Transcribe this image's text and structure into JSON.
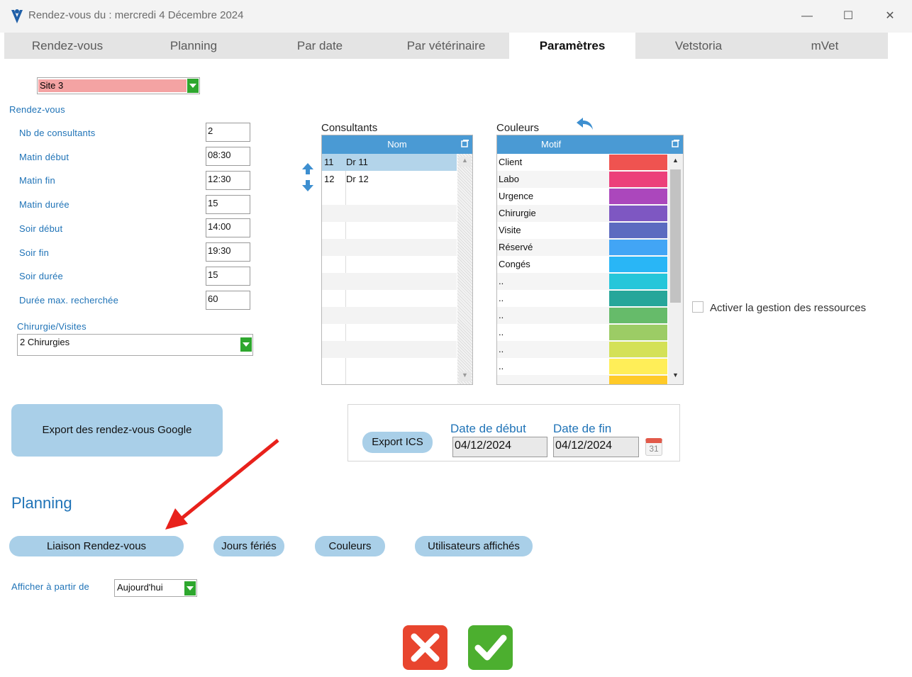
{
  "window": {
    "title": "Rendez-vous du : mercredi 4 Décembre 2024",
    "minimize": "—",
    "maximize": "☐",
    "close": "✕"
  },
  "tabs": [
    "Rendez-vous",
    "Planning",
    "Par date",
    "Par vétérinaire",
    "Paramètres",
    "Vetstoria",
    "mVet"
  ],
  "active_tab": "Paramètres",
  "site": {
    "value": "Site 3"
  },
  "rdv_section": "Rendez-vous",
  "fields": [
    {
      "label": "Nb de consultants",
      "value": "2"
    },
    {
      "label": "Matin début",
      "value": "08:30"
    },
    {
      "label": "Matin fin",
      "value": "12:30"
    },
    {
      "label": "Matin durée",
      "value": "15"
    },
    {
      "label": "Soir début",
      "value": "14:00"
    },
    {
      "label": "Soir fin",
      "value": "19:30"
    },
    {
      "label": "Soir durée",
      "value": "15"
    },
    {
      "label": "Durée max. recherchée",
      "value": "60"
    }
  ],
  "chirurgie": {
    "label": "Chirurgie/Visites",
    "value": "2 Chirurgies"
  },
  "consultants": {
    "title": "Consultants",
    "column": "Nom",
    "rows": [
      {
        "id": "11",
        "name": "Dr 11"
      },
      {
        "id": "12",
        "name": "Dr 12"
      }
    ]
  },
  "couleurs": {
    "title": "Couleurs",
    "column": "Motif",
    "rows": [
      {
        "motif": "Client",
        "color": "#ef5350"
      },
      {
        "motif": "Labo",
        "color": "#ec407a"
      },
      {
        "motif": "Urgence",
        "color": "#ab47bc"
      },
      {
        "motif": "Chirurgie",
        "color": "#7e57c2"
      },
      {
        "motif": "Visite",
        "color": "#5c6bc0"
      },
      {
        "motif": "Réservé",
        "color": "#42a5f5"
      },
      {
        "motif": "Congés",
        "color": "#29b6f6"
      },
      {
        "motif": "..",
        "color": "#26c6da"
      },
      {
        "motif": "..",
        "color": "#26a69a"
      },
      {
        "motif": "..",
        "color": "#66bb6a"
      },
      {
        "motif": "..",
        "color": "#9ccc65"
      },
      {
        "motif": "..",
        "color": "#d4e157"
      },
      {
        "motif": "..",
        "color": "#ffee58"
      },
      {
        "motif": "",
        "color": "#ffca28"
      }
    ]
  },
  "ressources": {
    "label": "Activer la gestion des ressources"
  },
  "export_google": "Export des rendez-vous Google",
  "export_ics": {
    "button": "Export ICS",
    "start_label": "Date de début",
    "start_value": "04/12/2024",
    "end_label": "Date de fin",
    "end_value": "04/12/2024",
    "calendar_day": "31"
  },
  "planning": {
    "title": "Planning",
    "buttons": [
      "Liaison Rendez-vous",
      "Jours fériés",
      "Couleurs",
      "Utilisateurs affichés"
    ],
    "afficher_label": "Afficher à partir de",
    "afficher_value": "Aujourd'hui"
  },
  "colors": {
    "accent": "#1f73b7",
    "cancel": "#e8452e",
    "ok": "#4caf2f"
  }
}
